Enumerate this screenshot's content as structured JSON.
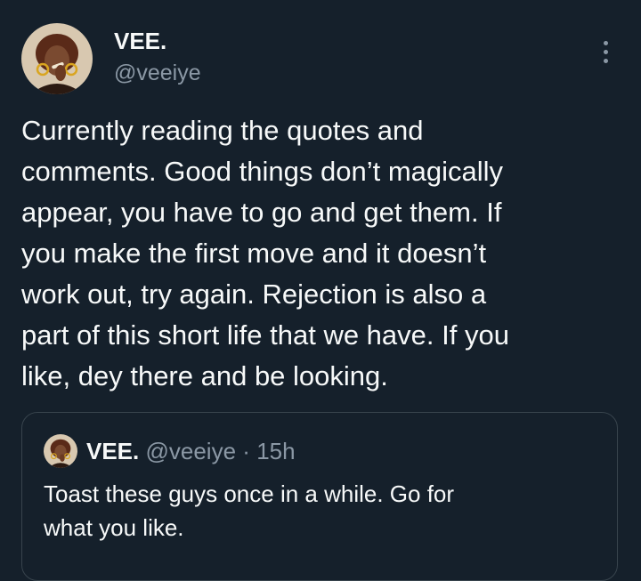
{
  "author": {
    "display_name": "VEE.",
    "handle": "@veeiye",
    "avatar_icon": "profile-photo-avatar"
  },
  "more_icon": "more-options-icon",
  "tweet": {
    "text": "Currently reading the quotes and\ncomments. Good things don’t magically\nappear, you have to go and get them. If\nyou make the first move and it doesn’t\nwork out, try again. Rejection is also a\npart of this short life that we have. If you\nlike, dey there and be looking."
  },
  "quoted_tweet": {
    "display_name": "VEE.",
    "handle": "@veeiye",
    "separator": "·",
    "time": "15h",
    "text": "Toast these guys once in a while. Go for\nwhat you like."
  },
  "colors": {
    "background": "#15202b",
    "primary_text": "#f7f9f9",
    "secondary_text": "#8b98a5",
    "border": "#38444d"
  }
}
